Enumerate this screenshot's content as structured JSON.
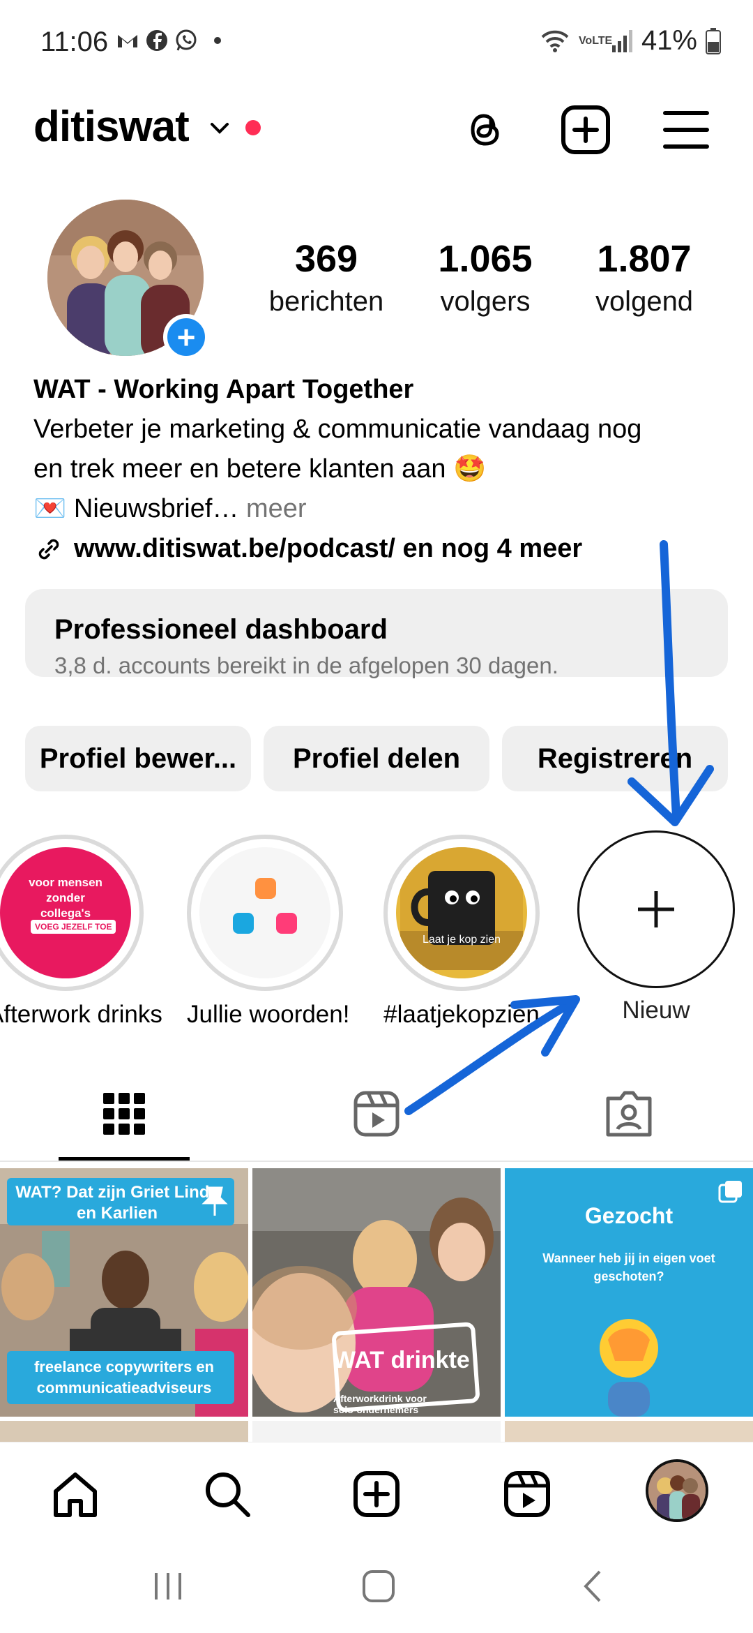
{
  "status_bar": {
    "time": "11:06",
    "battery": "41%",
    "network_label": "VoLTE"
  },
  "header": {
    "username": "ditiswat",
    "icons": [
      "threads-icon",
      "create-post-icon",
      "menu-icon"
    ]
  },
  "profile": {
    "stats": [
      {
        "value": "369",
        "label": "berichten"
      },
      {
        "value": "1.065",
        "label": "volgers"
      },
      {
        "value": "1.807",
        "label": "volgend"
      }
    ],
    "name": "WAT - Working Apart Together",
    "bio_line1": "Verbeter je marketing & communicatie vandaag nog",
    "bio_line2": "en trek meer en betere klanten aan 🤩",
    "bio_line3": "💌 Nieuwsbrief…",
    "bio_more": " meer",
    "link": "www.ditiswat.be/podcast/ en nog 4 meer"
  },
  "dashboard": {
    "title": "Professioneel dashboard",
    "subtitle": "3,8 d. accounts bereikt in de afgelopen 30 dagen."
  },
  "actions": {
    "edit": "Profiel bewer...",
    "share": "Profiel delen",
    "register": "Registreren"
  },
  "highlights": [
    {
      "label": "Afterwork drinks",
      "inner_text_1": "voor mensen zonder collega's",
      "inner_text_2": "VOEG JEZELF TOE"
    },
    {
      "label": "Jullie woorden!"
    },
    {
      "label": "#laatjekopzien",
      "inner_text": "Laat je kop zien"
    },
    {
      "label": "Nieuw"
    }
  ],
  "posts": [
    {
      "top_text": "WAT? Dat zijn Griet Linde en Karlien",
      "bottom_text": "freelance copywriters en communicatieadviseurs"
    },
    {
      "title": "WAT drinkte",
      "subtitle": "Afterworkdrink voor solo-ondernemers"
    },
    {
      "title": "Gezocht",
      "subtitle": "Wanneer heb jij in eigen voet geschoten?"
    }
  ],
  "colors": {
    "accent_blue": "#1a8cf0",
    "live_dot": "#ff2d55",
    "annotation_blue": "#1565d8",
    "post3_bg": "#29a9dc"
  }
}
